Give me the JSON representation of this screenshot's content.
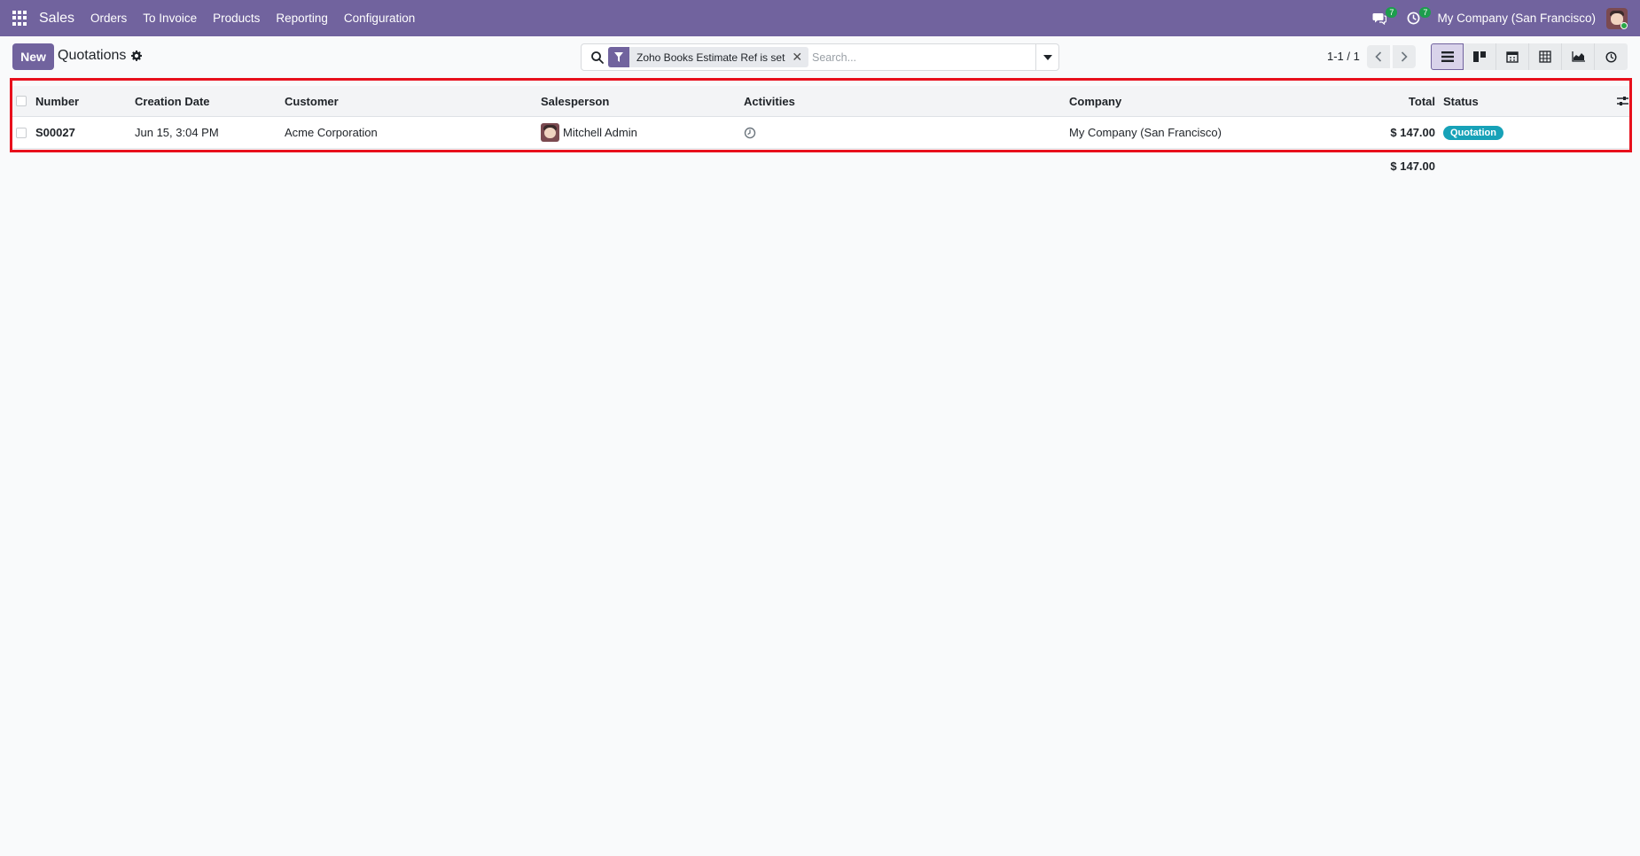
{
  "navbar": {
    "app_name": "Sales",
    "menu": [
      "Orders",
      "To Invoice",
      "Products",
      "Reporting",
      "Configuration"
    ],
    "messages_count": "7",
    "activities_count": "7",
    "company": "My Company (San Francisco)",
    "accent_color": "#71639e"
  },
  "control_panel": {
    "new_label": "New",
    "title": "Quotations",
    "facet_label": "Zoho Books Estimate Ref is set",
    "search_placeholder": "Search...",
    "pager": "1-1 / 1",
    "views": [
      "list-icon",
      "kanban-icon",
      "calendar-icon",
      "pivot-icon",
      "graph-icon",
      "activity-icon"
    ]
  },
  "list": {
    "columns": {
      "number": "Number",
      "creation_date": "Creation Date",
      "customer": "Customer",
      "salesperson": "Salesperson",
      "activities": "Activities",
      "company": "Company",
      "total": "Total",
      "status": "Status"
    },
    "rows": [
      {
        "number": "S00027",
        "creation_date": "Jun 15, 3:04 PM",
        "customer": "Acme Corporation",
        "salesperson": "Mitchell Admin",
        "company": "My Company (San Francisco)",
        "total": "$ 147.00",
        "status": "Quotation",
        "status_color": "#17a2b8"
      }
    ],
    "grand_total": "$ 147.00"
  }
}
